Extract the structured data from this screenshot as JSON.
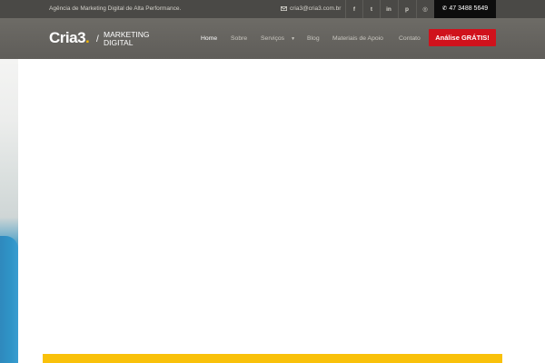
{
  "topbar": {
    "tagline": "Agência de Marketing Digital de Alta Performance.",
    "email": "cria3@cria3.com.br",
    "email_icon": "envelope-icon",
    "social": [
      {
        "name": "facebook",
        "glyph": "f"
      },
      {
        "name": "twitter",
        "glyph": "t"
      },
      {
        "name": "linkedin",
        "glyph": "in"
      },
      {
        "name": "pinterest",
        "glyph": "p"
      },
      {
        "name": "instagram",
        "glyph": "◎"
      }
    ],
    "phone": "47 3488 5649",
    "phone_icon": "phone-icon"
  },
  "header": {
    "logo": {
      "brand": "Cria3",
      "dot": ".",
      "slash": "/",
      "line1": "MARKETING",
      "line2": "DIGITAL"
    },
    "nav": [
      {
        "label": "Home",
        "active": true
      },
      {
        "label": "Sobre",
        "active": false
      },
      {
        "label": "Serviços",
        "active": false,
        "has_dropdown": true,
        "caret": "▼"
      },
      {
        "label": "Blog",
        "active": false
      },
      {
        "label": "Materiais de Apoio",
        "active": false
      },
      {
        "label": "Contato",
        "active": false
      }
    ],
    "cta_label": "Análise GRÁTIS!"
  },
  "colors": {
    "topbar_bg": "#4a4946",
    "header_bg": "#65635f",
    "cta_bg": "#d0121c",
    "accent_yellow": "#f9c10a",
    "logo_dot": "#f2b705"
  }
}
